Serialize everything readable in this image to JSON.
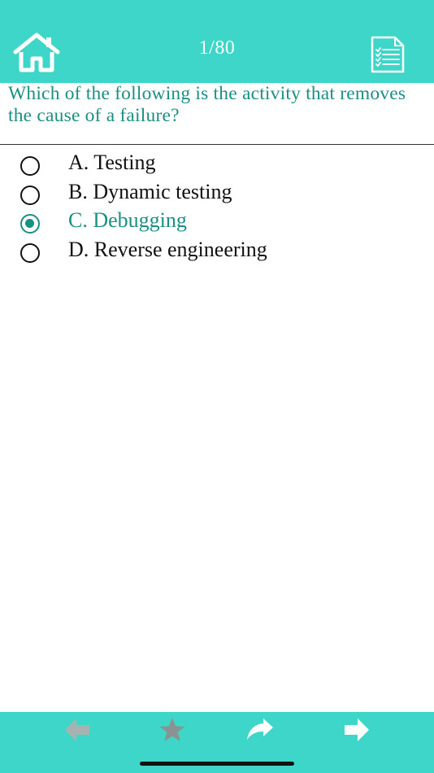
{
  "header": {
    "counter": "1/80",
    "background_color": "#3dd6c8",
    "home_icon": "home-icon",
    "list_icon": "checklist-icon"
  },
  "question": {
    "text": "Which of the following is the activity that removes the cause of a failure?",
    "color": "#1a8f84"
  },
  "options": [
    {
      "label": "A. Testing",
      "selected": false
    },
    {
      "label": "B. Dynamic testing",
      "selected": false
    },
    {
      "label": "C. Debugging",
      "selected": true
    },
    {
      "label": "D. Reverse engineering",
      "selected": false
    }
  ],
  "footer": {
    "buttons": [
      {
        "icon": "arrow-left-icon",
        "enabled": false
      },
      {
        "icon": "star-icon",
        "enabled": false
      },
      {
        "icon": "share-icon",
        "enabled": true
      },
      {
        "icon": "arrow-right-icon",
        "enabled": true
      }
    ]
  }
}
